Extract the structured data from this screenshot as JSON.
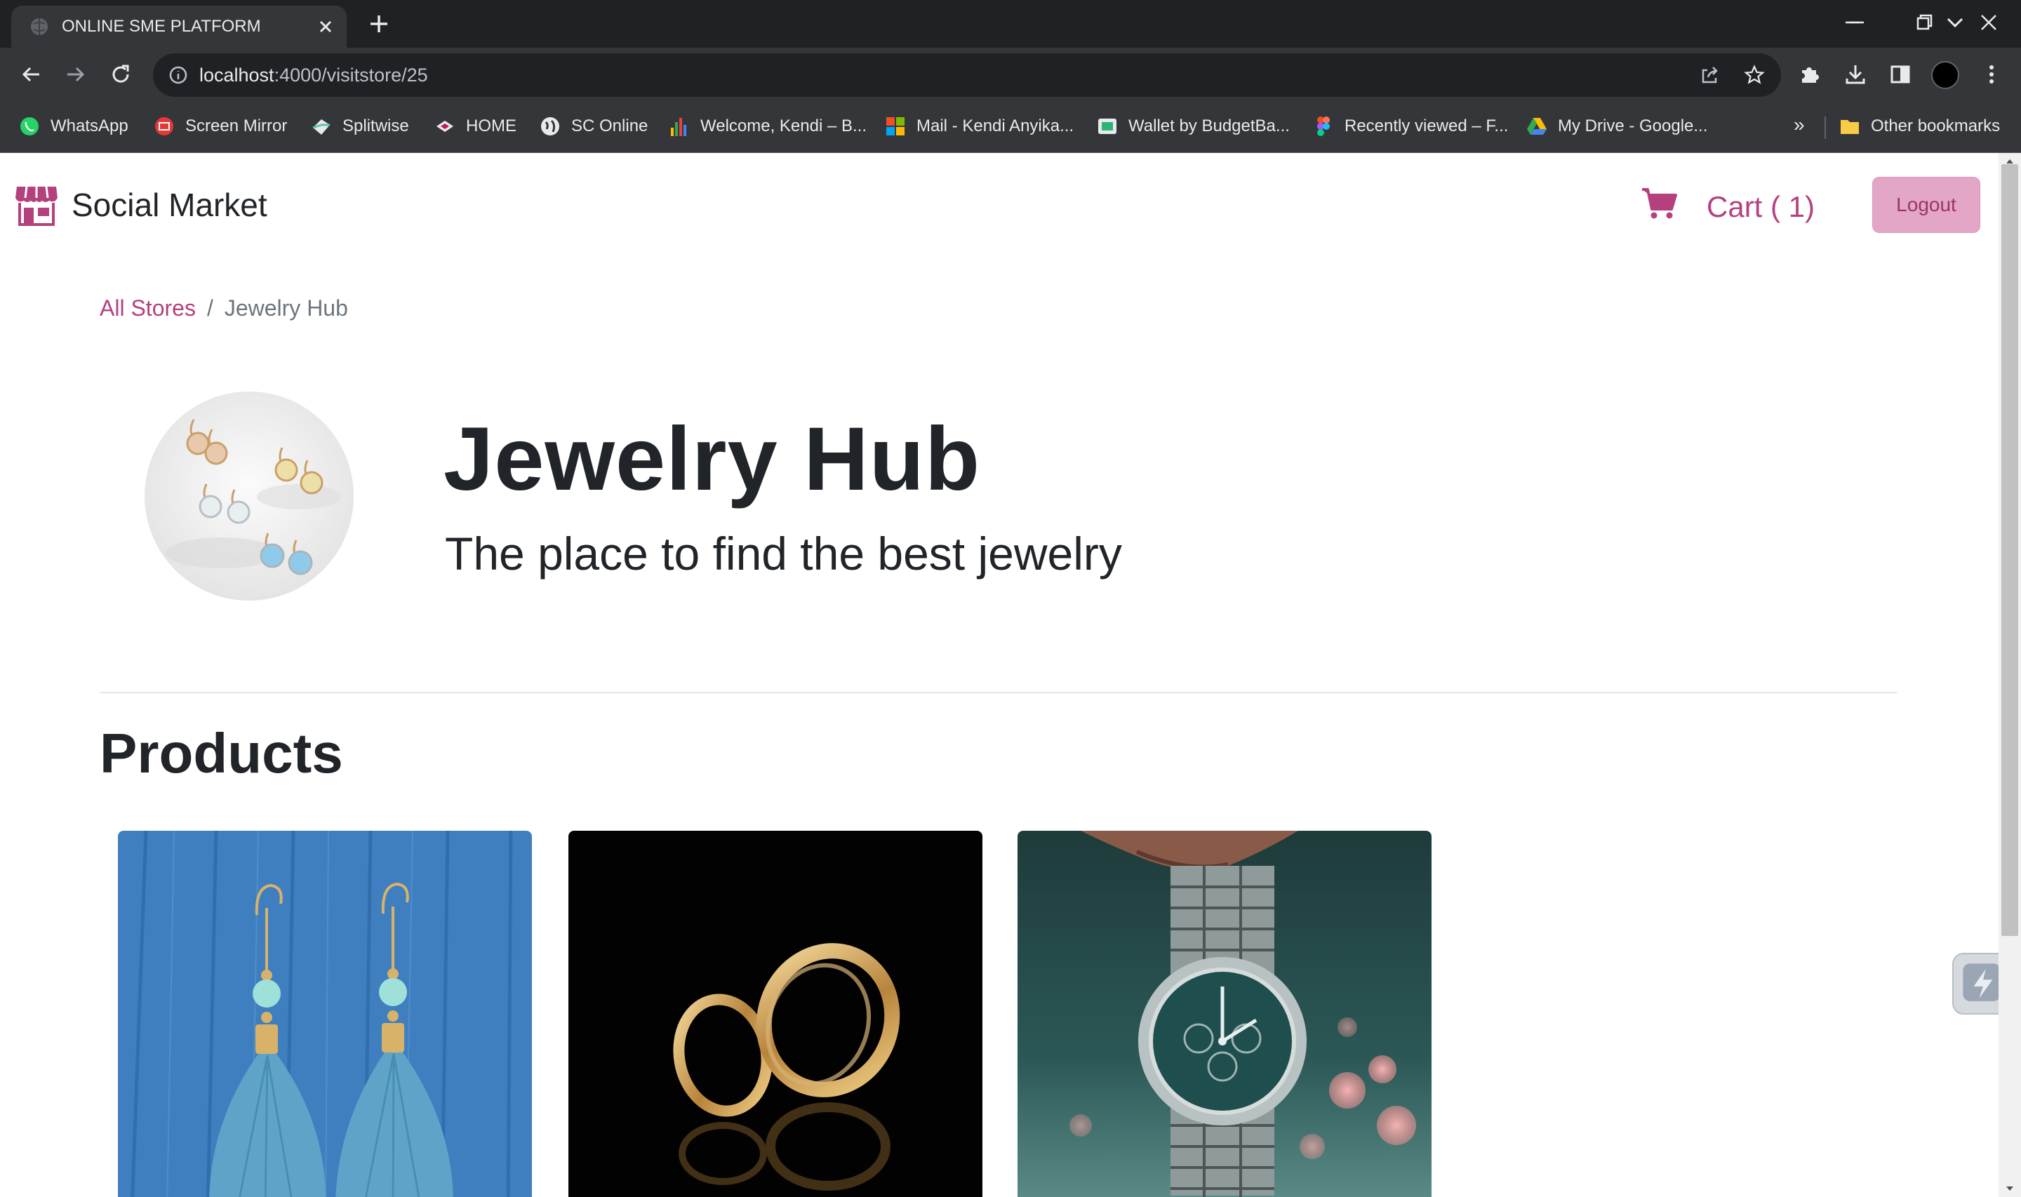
{
  "browser": {
    "tab": {
      "title": "ONLINE SME PLATFORM"
    },
    "address": {
      "host": "localhost",
      "path": ":4000/visitstore/25"
    },
    "bookmarks": [
      {
        "label": "WhatsApp",
        "icon": "whatsapp-icon"
      },
      {
        "label": "Screen Mirror",
        "icon": "screen-mirror-icon"
      },
      {
        "label": "Splitwise",
        "icon": "splitwise-icon"
      },
      {
        "label": "HOME",
        "icon": "home-bookmark-icon"
      },
      {
        "label": "SC Online",
        "icon": "globe-icon"
      },
      {
        "label": "Welcome, Kendi – B...",
        "icon": "bar-chart-icon"
      },
      {
        "label": "Mail - Kendi Anyika...",
        "icon": "microsoft-icon"
      },
      {
        "label": "Wallet by BudgetBa...",
        "icon": "wallet-icon"
      },
      {
        "label": "Recently viewed – F...",
        "icon": "figma-icon"
      },
      {
        "label": "My Drive - Google...",
        "icon": "google-drive-icon"
      }
    ],
    "bookmarks_overflow": "»",
    "other_bookmarks": "Other bookmarks"
  },
  "navbar": {
    "brand": "Social Market",
    "cart_label": "Cart ( 1)",
    "logout_label": "Logout"
  },
  "breadcrumb": {
    "link": "All Stores",
    "separator": "/",
    "current": "Jewelry Hub"
  },
  "store": {
    "name": "Jewelry Hub",
    "tagline": "The place to find the best jewelry"
  },
  "products": {
    "heading": "Products",
    "items": [
      {
        "image": "blue-tassel-earrings-image"
      },
      {
        "image": "gold-hoop-earrings-image"
      },
      {
        "image": "silver-wristwatch-image"
      }
    ]
  },
  "colors": {
    "accent": "#b4417e",
    "logout_bg": "#e3a6c6",
    "chrome_dark": "#202124",
    "chrome_mid": "#35363a"
  }
}
